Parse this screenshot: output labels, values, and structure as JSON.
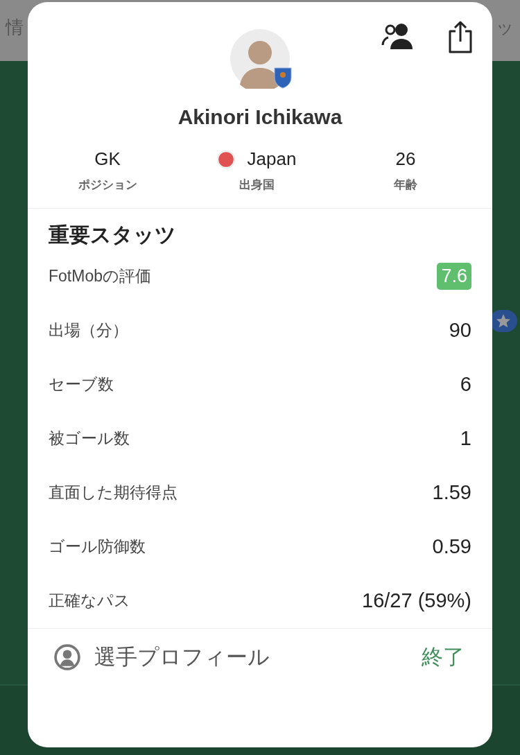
{
  "background": {
    "tabs": [
      {
        "label": "情"
      },
      {
        "label": "ッ"
      }
    ]
  },
  "player": {
    "name": "Akinori Ichikawa",
    "info": [
      {
        "kind": "text",
        "value": "GK",
        "label": "ポジション"
      },
      {
        "kind": "flag",
        "value": "Japan",
        "label": "出身国"
      },
      {
        "kind": "text",
        "value": "26",
        "label": "年齢"
      }
    ]
  },
  "stats": {
    "title": "重要スタッツ",
    "rows": [
      {
        "kind": "badge",
        "label": "FotMobの評価",
        "value": "7.6",
        "color": "#5fbf6e"
      },
      {
        "kind": "plain",
        "label": "出場（分）",
        "value": "90"
      },
      {
        "kind": "plain",
        "label": "セーブ数",
        "value": "6"
      },
      {
        "kind": "plain",
        "label": "被ゴール数",
        "value": "1"
      },
      {
        "kind": "plain",
        "label": "直面した期待得点",
        "value": "1.59"
      },
      {
        "kind": "plain",
        "label": "ゴール防御数",
        "value": "0.59"
      },
      {
        "kind": "plain",
        "label": "正確なパス",
        "value": "16/27 (59%)"
      }
    ]
  },
  "footer": {
    "profile": "選手プロフィール",
    "close": "終了"
  }
}
